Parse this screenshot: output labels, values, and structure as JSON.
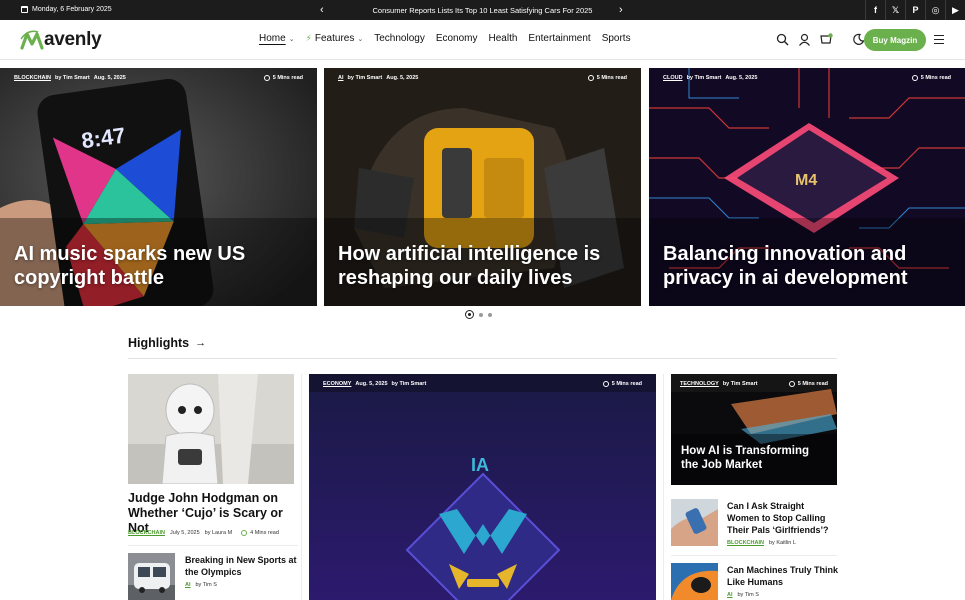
{
  "topbar": {
    "date": "Monday, 6 February 2025",
    "ticker": "Consumer Reports Lists Its Top 10 Least Satisfying Cars For 2025",
    "prev": "‹",
    "next": "›",
    "socials": [
      "f",
      "𝕏",
      "P",
      "◎",
      "▶"
    ]
  },
  "brand": {
    "logo_text": "avenly",
    "accent": "#6ab04c"
  },
  "nav": {
    "items": [
      "Home",
      "Features",
      "Technology",
      "Economy",
      "Health",
      "Entertainment",
      "Sports"
    ],
    "buy_label": "Buy Magzin"
  },
  "hero": [
    {
      "category": "BLOCKCHAIN",
      "author": "by Tim Smart",
      "date": "Aug. 5, 2025",
      "read": "5 Mins read",
      "title": "AI music sparks new US copyright battle"
    },
    {
      "category": "AI",
      "author": "by Tim Smart",
      "date": "Aug. 5, 2025",
      "read": "5 Mins read",
      "title": "How artificial intelligence is reshaping our daily lives"
    },
    {
      "category": "CLOUD",
      "author": "by Tim Smart",
      "date": "Aug. 5, 2025",
      "read": "5 Mins read",
      "title": "Balancing innovation and privacy in ai development"
    }
  ],
  "highlights": {
    "heading": "Highlights",
    "arrow": "→",
    "left_main": {
      "title": "Judge John Hodgman on Whether ‘Cujo’ is Scary or Not",
      "category": "BLOCKCHAIN",
      "date": "July 5, 2025",
      "author": "by Laura M",
      "read": "4 Mins read"
    },
    "left_small": {
      "title": "Breaking in New Sports at the Olympics",
      "category": "AI",
      "author": "by Tim S"
    },
    "center": {
      "category": "ECONOMY",
      "date": "Aug. 5, 2025",
      "author": "by Tim Smart",
      "read": "5 Mins read",
      "image_text": "IA"
    },
    "right_main": {
      "category": "TECHNOLOGY",
      "author": "by Tim Smart",
      "read": "5 Mins read",
      "title": "How AI is Transforming the Job Market"
    },
    "right_list": [
      {
        "title": "Can I Ask Straight Women to Stop Calling Their Pals ‘Girlfriends’?",
        "category": "BLOCKCHAIN",
        "author": "by Kaitlin L"
      },
      {
        "title": "Can Machines Truly Think Like Humans",
        "category": "AI",
        "author": "by Tim S"
      }
    ]
  }
}
